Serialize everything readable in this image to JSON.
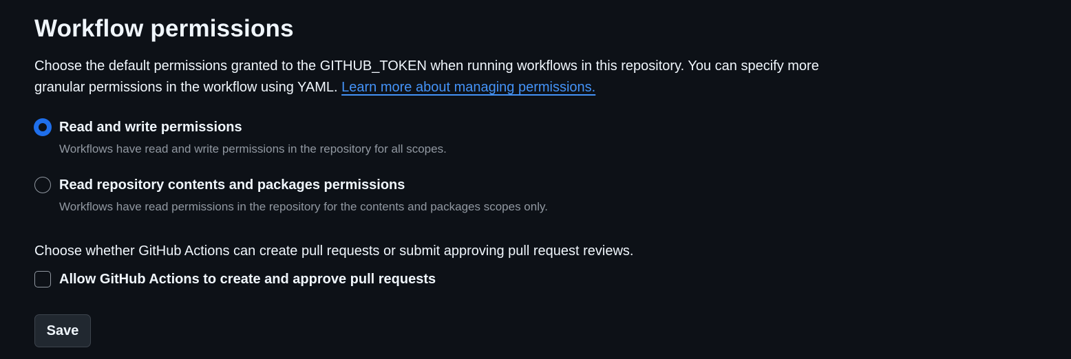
{
  "section": {
    "title": "Workflow permissions",
    "description": "Choose the default permissions granted to the GITHUB_TOKEN when running workflows in this repository. You can specify more granular permissions in the workflow using YAML.",
    "learn_more_link": "Learn more about managing permissions."
  },
  "permission_options": [
    {
      "label": "Read and write permissions",
      "description": "Workflows have read and write permissions in the repository for all scopes.",
      "selected": true
    },
    {
      "label": "Read repository contents and packages permissions",
      "description": "Workflows have read permissions in the repository for the contents and packages scopes only.",
      "selected": false
    }
  ],
  "pull_requests": {
    "description": "Choose whether GitHub Actions can create pull requests or submit approving pull request reviews.",
    "checkbox_label": "Allow GitHub Actions to create and approve pull requests",
    "checked": false
  },
  "actions": {
    "save_label": "Save"
  },
  "colors": {
    "background": "#0d1117",
    "text": "#f0f6fc",
    "muted_text": "#9198a1",
    "link": "#4493f8",
    "accent": "#1f6feb",
    "button_bg": "#212830",
    "button_border": "#3d444d"
  },
  "icons": {
    "radio_selected": "radio-checked-icon",
    "radio_unselected": "radio-unchecked-icon",
    "checkbox_unchecked": "checkbox-unchecked-icon"
  }
}
